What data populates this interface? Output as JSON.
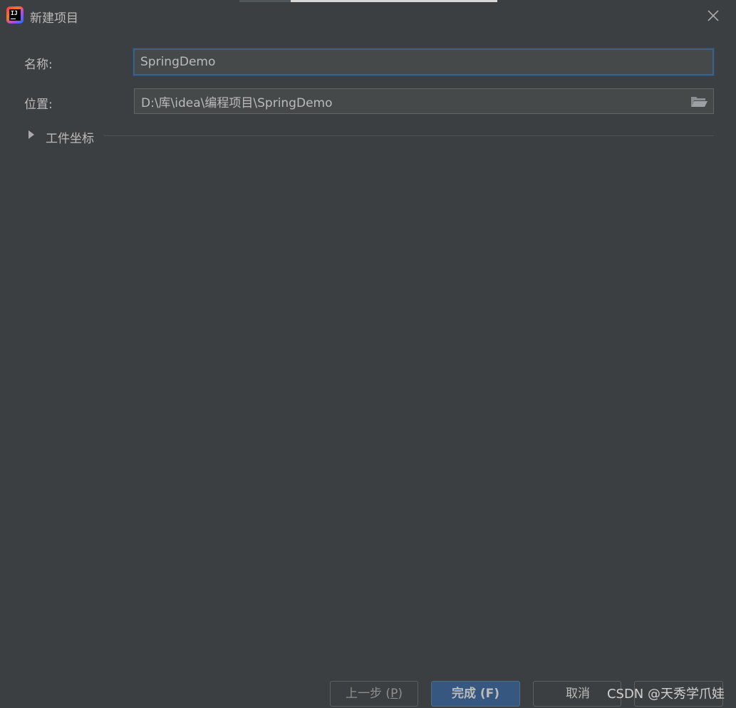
{
  "window": {
    "title": "新建项目",
    "app_icon": "intellij-idea-icon",
    "close_icon": "close-icon",
    "app_icon_text": "IJ"
  },
  "form": {
    "name_label": "名称:",
    "name_value": "SpringDemo",
    "location_label": "位置:",
    "location_value": "D:\\库\\idea\\编程项目\\SpringDemo",
    "browse_icon": "folder-icon"
  },
  "artifact_section": {
    "label": "工件坐标",
    "icon": "triangle-right-icon",
    "expanded": false
  },
  "buttons": {
    "previous": {
      "label": "上一步 (",
      "mnemonic": "P",
      "suffix": ")",
      "enabled": false
    },
    "finish": {
      "label": "完成 (F)"
    },
    "cancel": {
      "label": "取消"
    },
    "help": {
      "label": ""
    }
  },
  "watermark": "CSDN @天秀学爪娃",
  "colors": {
    "background": "#3c3f41",
    "input_background": "#45494a",
    "focus_border": "#3d6185",
    "primary_button": "#365880",
    "text": "#bbbbbb"
  }
}
